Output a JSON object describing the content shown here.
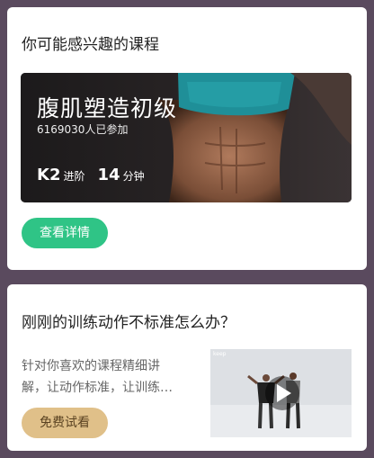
{
  "recommend_card": {
    "title": "你可能感兴趣的课程",
    "course": {
      "name": "腹肌塑造初级",
      "participants": "6169030人已参加",
      "level_value": "K2",
      "level_label": "进阶",
      "duration_value": "14",
      "duration_label": "分钟"
    },
    "detail_button": "查看详情"
  },
  "help_card": {
    "title": "刚刚的训练动作不标准怎么办？",
    "description_lines": [
      "针对你喜欢的课程精细讲",
      "解，让动作标准，让训练…"
    ],
    "trial_button": "免费试看",
    "video_tag": "keep"
  },
  "colors": {
    "primary_green": "#2fc486",
    "gold": "#e0c089",
    "background": "#5a4a5e"
  }
}
